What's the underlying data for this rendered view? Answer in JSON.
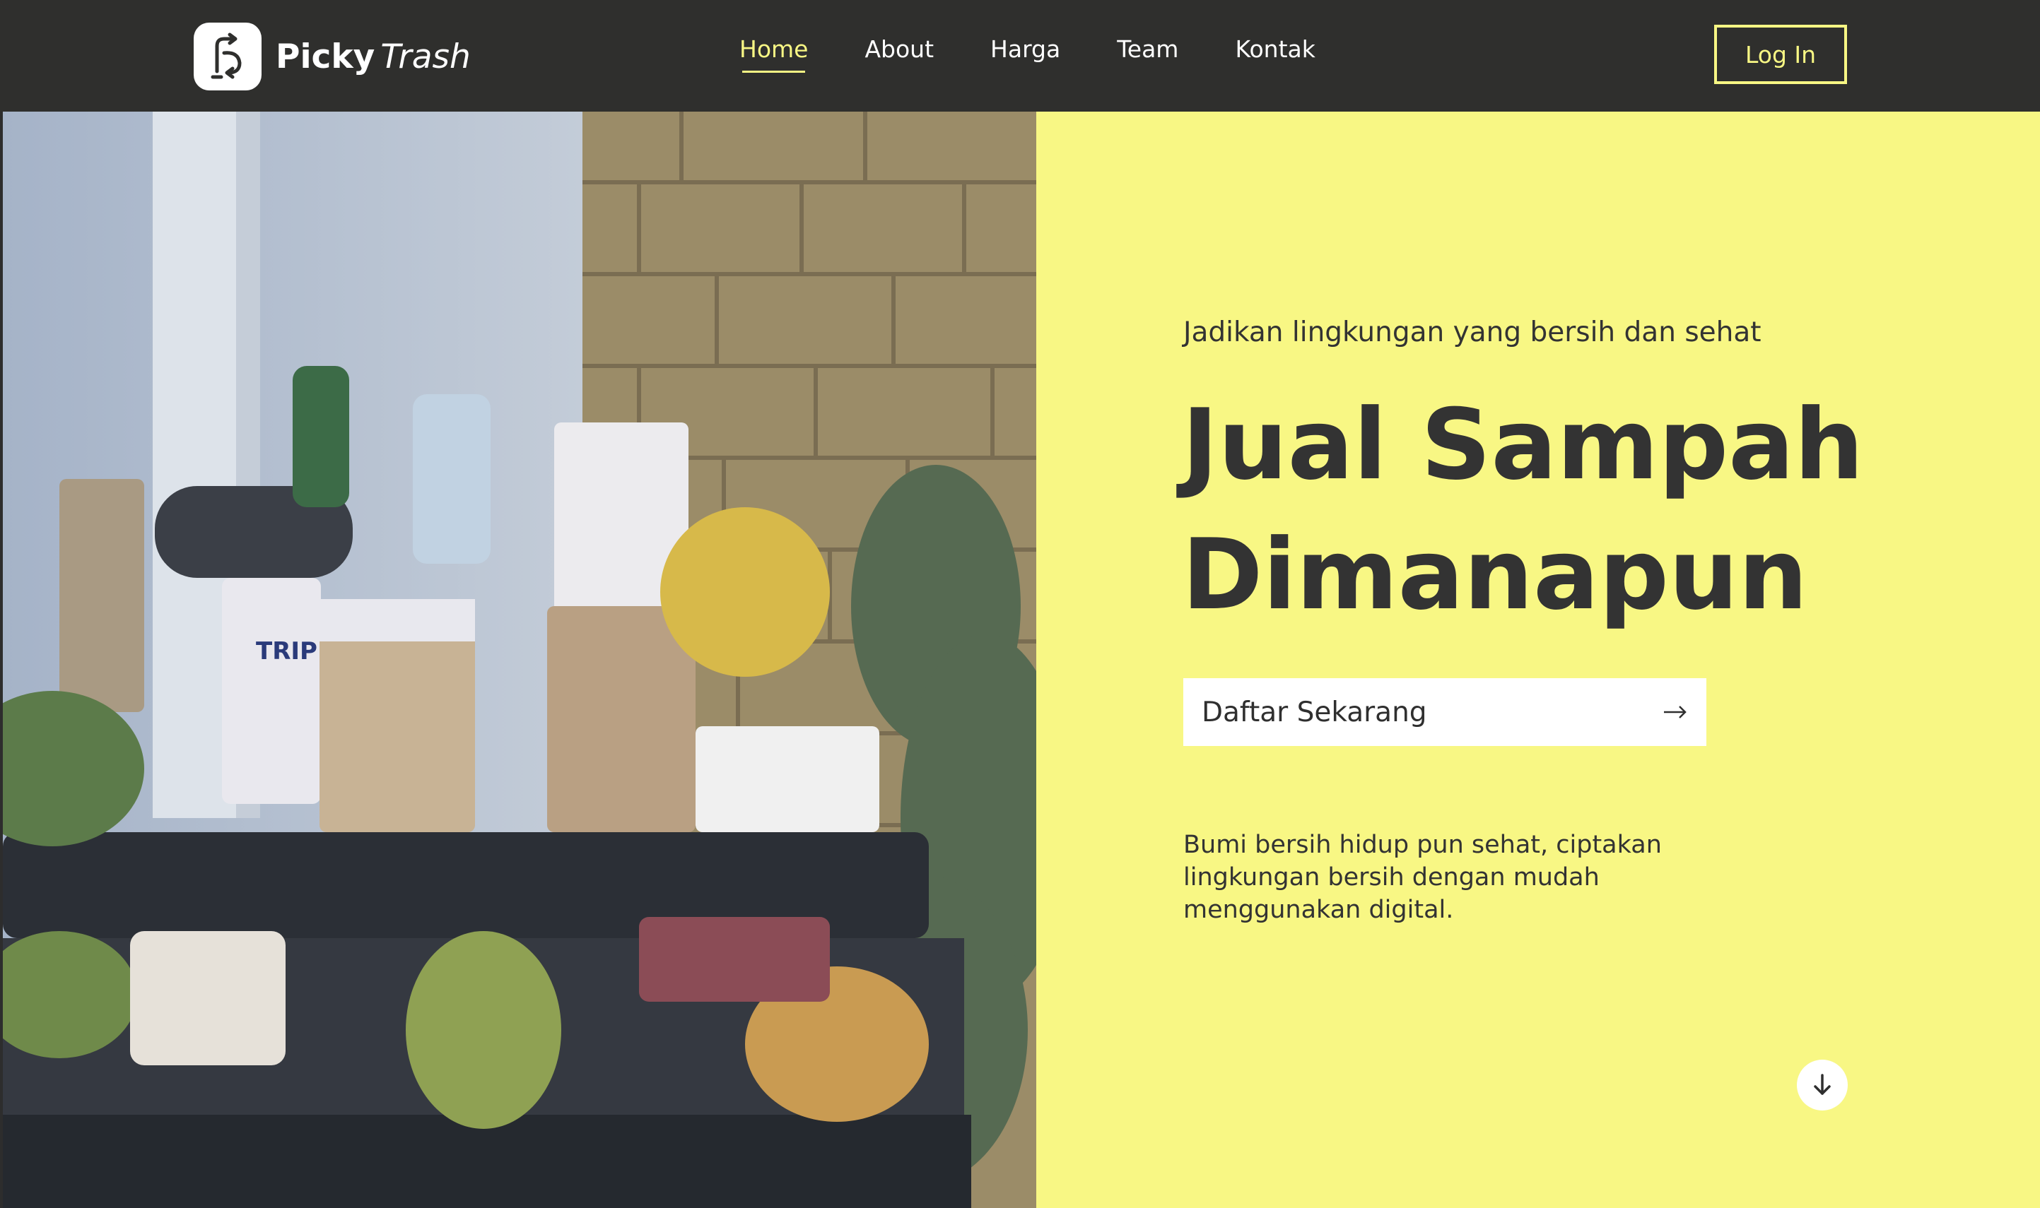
{
  "brand": {
    "name_bold": "Picky",
    "name_italic": "Trash",
    "logo_icon": "recycle-logo-icon"
  },
  "nav": {
    "items": [
      {
        "label": "Home",
        "active": true
      },
      {
        "label": "About",
        "active": false
      },
      {
        "label": "Harga",
        "active": false
      },
      {
        "label": "Team",
        "active": false
      },
      {
        "label": "Kontak",
        "active": false
      }
    ],
    "login_label": "Log In"
  },
  "hero": {
    "image_subject": "overflowing trash bins with cups, cans and bottles",
    "tagline": "Jadikan lingkungan yang bersih dan sehat",
    "headline_line1": "Jual Sampah",
    "headline_line2": "Dimanapun",
    "cta_label": "Daftar Sekarang",
    "cta_icon": "arrow-right-icon",
    "description": "Bumi bersih hidup pun sehat, ciptakan lingkungan bersih dengan mudah menggunakan digital.",
    "scroll_icon": "arrow-down-icon"
  },
  "colors": {
    "accent": "#f8f784",
    "navbar": "#2f2f2d",
    "text_dark": "#333333",
    "white": "#ffffff"
  }
}
